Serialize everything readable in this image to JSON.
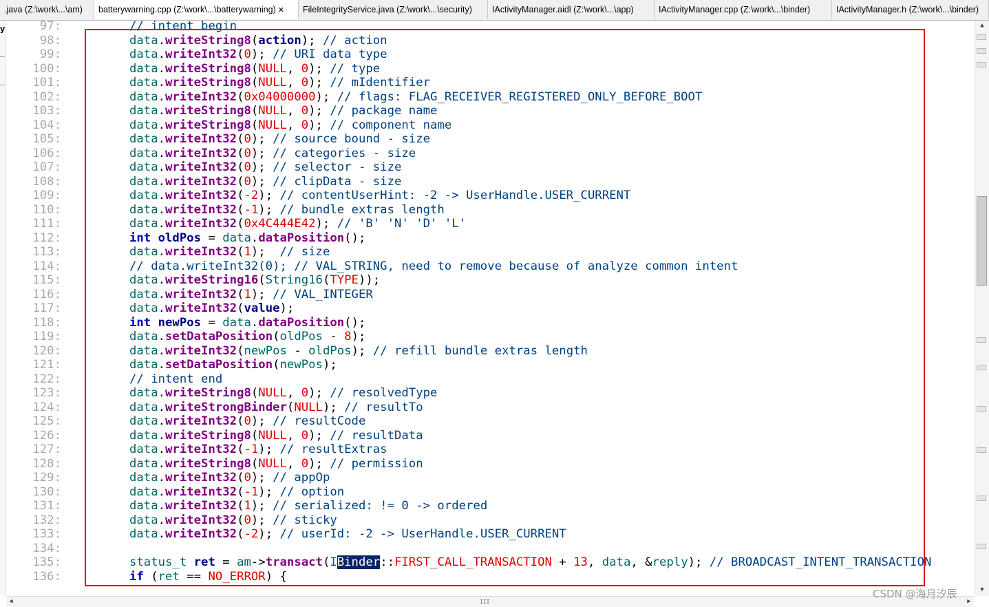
{
  "tabs": [
    {
      "label": ".java (Z:\\work\\...\\am)",
      "active": false
    },
    {
      "label": "batterywarning.cpp (Z:\\work\\...\\batterywarning)",
      "active": true,
      "close": "✕"
    },
    {
      "label": "FileIntegrityService.java (Z:\\work\\...\\security)",
      "active": false
    },
    {
      "label": "IActivityManager.aidl (Z:\\work\\...\\app)",
      "active": false
    },
    {
      "label": "IActivityManager.cpp (Z:\\work\\...\\binder)",
      "active": false
    },
    {
      "label": "IActivityManager.h (Z:\\work\\...\\binder)",
      "active": false
    }
  ],
  "left_marker": "y",
  "lines": [
    {
      "no": "97:",
      "html": "<span class='c'>// intent begin</span>"
    },
    {
      "no": "98:",
      "html": "<span class='k'>data</span>.<span class='f'>writeString8</span>(<span class='v'>action</span>); <span class='c'>// action</span>"
    },
    {
      "no": "99:",
      "html": "<span class='k'>data</span>.<span class='f'>writeInt32</span>(<span class='n'>0</span>); <span class='c'>// URI data type</span>"
    },
    {
      "no": "100:",
      "html": "<span class='k'>data</span>.<span class='f'>writeString8</span>(<span class='n'>NULL</span>, <span class='n'>0</span>); <span class='c'>// type</span>"
    },
    {
      "no": "101:",
      "html": "<span class='k'>data</span>.<span class='f'>writeString8</span>(<span class='n'>NULL</span>, <span class='n'>0</span>); <span class='c'>// mIdentifier</span>"
    },
    {
      "no": "102:",
      "html": "<span class='k'>data</span>.<span class='f'>writeInt32</span>(<span class='n'>0x04000000</span>); <span class='c'>// flags: FLAG_RECEIVER_REGISTERED_ONLY_BEFORE_BOOT</span>"
    },
    {
      "no": "103:",
      "html": "<span class='k'>data</span>.<span class='f'>writeString8</span>(<span class='n'>NULL</span>, <span class='n'>0</span>); <span class='c'>// package name</span>"
    },
    {
      "no": "104:",
      "html": "<span class='k'>data</span>.<span class='f'>writeString8</span>(<span class='n'>NULL</span>, <span class='n'>0</span>); <span class='c'>// component name</span>"
    },
    {
      "no": "105:",
      "html": "<span class='k'>data</span>.<span class='f'>writeInt32</span>(<span class='n'>0</span>); <span class='c'>// source bound - size</span>"
    },
    {
      "no": "106:",
      "html": "<span class='k'>data</span>.<span class='f'>writeInt32</span>(<span class='n'>0</span>); <span class='c'>// categories - size</span>"
    },
    {
      "no": "107:",
      "html": "<span class='k'>data</span>.<span class='f'>writeInt32</span>(<span class='n'>0</span>); <span class='c'>// selector - size</span>"
    },
    {
      "no": "108:",
      "html": "<span class='k'>data</span>.<span class='f'>writeInt32</span>(<span class='n'>0</span>); <span class='c'>// clipData - size</span>"
    },
    {
      "no": "109:",
      "html": "<span class='k'>data</span>.<span class='f'>writeInt32</span>(<span class='n'>-2</span>); <span class='c'>// contentUserHint: -2 -&gt; UserHandle.USER_CURRENT</span>"
    },
    {
      "no": "110:",
      "html": "<span class='k'>data</span>.<span class='f'>writeInt32</span>(<span class='n'>-1</span>); <span class='c'>// bundle extras length</span>"
    },
    {
      "no": "111:",
      "html": "<span class='k'>data</span>.<span class='f'>writeInt32</span>(<span class='n'>0x4C444E42</span>); <span class='c'>// 'B' 'N' 'D' 'L'</span>"
    },
    {
      "no": "112:",
      "html": "<span class='kw'>int</span> <span class='v'>oldPos</span> = <span class='k'>data</span>.<span class='f'>dataPosition</span>();"
    },
    {
      "no": "113:",
      "html": "<span class='k'>data</span>.<span class='f'>writeInt32</span>(<span class='n'>1</span>);  <span class='c'>// size</span>"
    },
    {
      "no": "114:",
      "html": "<span class='c'>// data.writeInt32(0); // VAL_STRING, need to remove because of analyze common intent</span>"
    },
    {
      "no": "115:",
      "html": "<span class='k'>data</span>.<span class='f'>writeString16</span>(<span class='t'>String16</span>(<span class='n'>TYPE</span>));"
    },
    {
      "no": "116:",
      "html": "<span class='k'>data</span>.<span class='f'>writeInt32</span>(<span class='n'>1</span>); <span class='c'>// VAL_INTEGER</span>"
    },
    {
      "no": "117:",
      "html": "<span class='k'>data</span>.<span class='f'>writeInt32</span>(<span class='v'>value</span>);"
    },
    {
      "no": "118:",
      "html": "<span class='kw'>int</span> <span class='v'>newPos</span> = <span class='k'>data</span>.<span class='f'>dataPosition</span>();"
    },
    {
      "no": "119:",
      "html": "<span class='k'>data</span>.<span class='f'>setDataPosition</span>(<span class='k'>oldPos</span> - <span class='n'>8</span>);"
    },
    {
      "no": "120:",
      "html": "<span class='k'>data</span>.<span class='f'>writeInt32</span>(<span class='k'>newPos</span> - <span class='k'>oldPos</span>); <span class='c'>// refill bundle extras length</span>"
    },
    {
      "no": "121:",
      "html": "<span class='k'>data</span>.<span class='f'>setDataPosition</span>(<span class='k'>newPos</span>);"
    },
    {
      "no": "122:",
      "html": "<span class='c'>// intent end</span>"
    },
    {
      "no": "123:",
      "html": "<span class='k'>data</span>.<span class='f'>writeString8</span>(<span class='n'>NULL</span>, <span class='n'>0</span>); <span class='c'>// resolvedType</span>"
    },
    {
      "no": "124:",
      "html": "<span class='k'>data</span>.<span class='f'>writeStrongBinder</span>(<span class='n'>NULL</span>); <span class='c'>// resultTo</span>"
    },
    {
      "no": "125:",
      "html": "<span class='k'>data</span>.<span class='f'>writeInt32</span>(<span class='n'>0</span>); <span class='c'>// resultCode</span>"
    },
    {
      "no": "126:",
      "html": "<span class='k'>data</span>.<span class='f'>writeString8</span>(<span class='n'>NULL</span>, <span class='n'>0</span>); <span class='c'>// resultData</span>"
    },
    {
      "no": "127:",
      "html": "<span class='k'>data</span>.<span class='f'>writeInt32</span>(<span class='n'>-1</span>); <span class='c'>// resultExtras</span>"
    },
    {
      "no": "128:",
      "html": "<span class='k'>data</span>.<span class='f'>writeString8</span>(<span class='n'>NULL</span>, <span class='n'>0</span>); <span class='c'>// permission</span>"
    },
    {
      "no": "129:",
      "html": "<span class='k'>data</span>.<span class='f'>writeInt32</span>(<span class='n'>0</span>); <span class='c'>// appOp</span>"
    },
    {
      "no": "130:",
      "html": "<span class='k'>data</span>.<span class='f'>writeInt32</span>(<span class='n'>-1</span>); <span class='c'>// option</span>"
    },
    {
      "no": "131:",
      "html": "<span class='k'>data</span>.<span class='f'>writeInt32</span>(<span class='n'>1</span>); <span class='c'>// serialized: != 0 -&gt; ordered</span>"
    },
    {
      "no": "132:",
      "html": "<span class='k'>data</span>.<span class='f'>writeInt32</span>(<span class='n'>0</span>); <span class='c'>// sticky</span>"
    },
    {
      "no": "133:",
      "html": "<span class='k'>data</span>.<span class='f'>writeInt32</span>(<span class='n'>-2</span>); <span class='c'>// userId: -2 -&gt; UserHandle.USER_CURRENT</span>"
    },
    {
      "no": "134:",
      "html": ""
    },
    {
      "no": "135:",
      "html": "<span class='t'>status_t</span> <span class='v'>ret</span> = <span class='k'>am</span>-&gt;<span class='f'>transact</span>(<span class='t'>I</span><span class='sel'>Binder</span>::<span class='n'>FIRST_CALL_TRANSACTION</span> + <span class='n'>13</span>, <span class='k'>data</span>, &amp;<span class='k'>reply</span>); <span class='c'>// BROADCAST_INTENT_TRANSACTION</span>"
    },
    {
      "no": "136:",
      "html": "<span class='kw'>if</span> (<span class='k'>ret</span> == <span class='n'>NO_ERROR</span>) {"
    }
  ],
  "hscroll_grip": "III",
  "scroll_up": "▲",
  "scroll_down": "▼",
  "scroll_left": "◀",
  "scroll_right": "▶",
  "watermark": "CSDN @海月汐辰"
}
